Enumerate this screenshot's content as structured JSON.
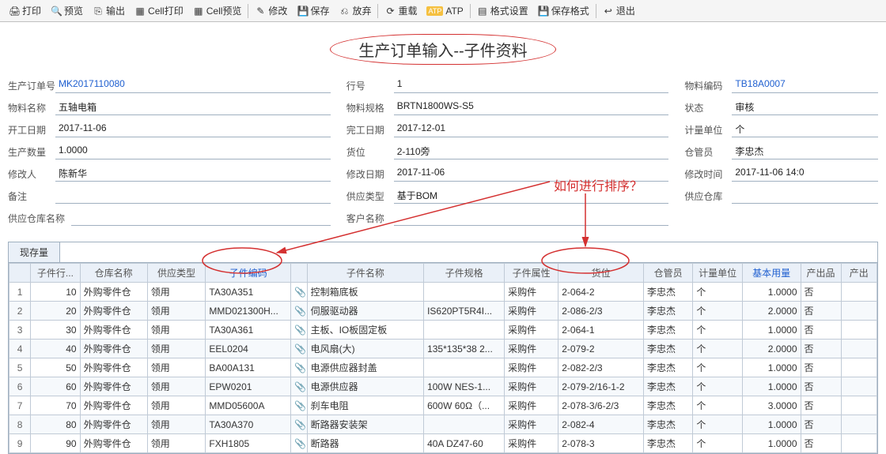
{
  "toolbar": {
    "print": "打印",
    "preview": "预览",
    "export": "输出",
    "cellprint": "Cell打印",
    "cellpreview": "Cell预览",
    "edit": "修改",
    "save": "保存",
    "discard": "放弃",
    "reload": "重载",
    "atp": "ATP",
    "format": "格式设置",
    "saveformat": "保存格式",
    "exit": "退出"
  },
  "title": "生产订单输入--子件资料",
  "annotation_text": "如何进行排序？",
  "form": {
    "left": {
      "order_no_label": "生产订单号",
      "order_no": "MK2017110080",
      "material_name_label": "物料名称",
      "material_name": "五轴电箱",
      "start_date_label": "开工日期",
      "start_date": "2017-11-06",
      "qty_label": "生产数量",
      "qty": "1.0000",
      "modifier_label": "修改人",
      "modifier": "陈新华",
      "remark_label": "备注",
      "remark": "",
      "supply_wh_name_label": "供应仓库名称",
      "supply_wh_name": ""
    },
    "mid": {
      "line_label": "行号",
      "line": "1",
      "spec_label": "物料规格",
      "spec": "BRTN1800WS-S5",
      "end_date_label": "完工日期",
      "end_date": "2017-12-01",
      "location_label": "货位",
      "location": "2-110旁",
      "mod_date_label": "修改日期",
      "mod_date": "2017-11-06",
      "supply_type_label": "供应类型",
      "supply_type": "基于BOM",
      "customer_label": "客户名称",
      "customer": ""
    },
    "right": {
      "material_code_label": "物料编码",
      "material_code": "TB18A0007",
      "status_label": "状态",
      "status": "审核",
      "uom_label": "计量单位",
      "uom": "个",
      "keeper_label": "仓管员",
      "keeper": "李忠杰",
      "mod_time_label": "修改时间",
      "mod_time": "2017-11-06 14:0",
      "supply_wh_label": "供应仓库",
      "supply_wh": ""
    }
  },
  "tab": "现存量",
  "columns": [
    "子件行...",
    "仓库名称",
    "供应类型",
    "子件编码",
    "",
    "子件名称",
    "子件规格",
    "子件属性",
    "货位",
    "仓管员",
    "计量单位",
    "基本用量",
    "产出品",
    "产出"
  ],
  "rows": [
    {
      "n": "1",
      "line": "10",
      "wh": "外购零件仓",
      "st": "领用",
      "code": "TA30A351",
      "name": "控制箱底板",
      "spec": "",
      "attr": "采购件",
      "loc": "2-064-2",
      "kp": "李忠杰",
      "uom": "个",
      "qty": "1.0000",
      "out": "否"
    },
    {
      "n": "2",
      "line": "20",
      "wh": "外购零件仓",
      "st": "领用",
      "code": "MMD021300H...",
      "name": "伺服驱动器",
      "spec": "IS620PT5R4I...",
      "attr": "采购件",
      "loc": "2-086-2/3",
      "kp": "李忠杰",
      "uom": "个",
      "qty": "2.0000",
      "out": "否"
    },
    {
      "n": "3",
      "line": "30",
      "wh": "外购零件仓",
      "st": "领用",
      "code": "TA30A361",
      "name": "主板、IO板固定板",
      "spec": "",
      "attr": "采购件",
      "loc": "2-064-1",
      "kp": "李忠杰",
      "uom": "个",
      "qty": "1.0000",
      "out": "否"
    },
    {
      "n": "4",
      "line": "40",
      "wh": "外购零件仓",
      "st": "领用",
      "code": "EEL0204",
      "name": "电风扇(大)",
      "spec": "135*135*38 2...",
      "attr": "采购件",
      "loc": "2-079-2",
      "kp": "李忠杰",
      "uom": "个",
      "qty": "2.0000",
      "out": "否"
    },
    {
      "n": "5",
      "line": "50",
      "wh": "外购零件仓",
      "st": "领用",
      "code": "BA00A131",
      "name": "电源供应器封盖",
      "spec": "",
      "attr": "采购件",
      "loc": "2-082-2/3",
      "kp": "李忠杰",
      "uom": "个",
      "qty": "1.0000",
      "out": "否"
    },
    {
      "n": "6",
      "line": "60",
      "wh": "外购零件仓",
      "st": "领用",
      "code": "EPW0201",
      "name": "电源供应器",
      "spec": "100W NES-1...",
      "attr": "采购件",
      "loc": "2-079-2/16-1-2",
      "kp": "李忠杰",
      "uom": "个",
      "qty": "1.0000",
      "out": "否"
    },
    {
      "n": "7",
      "line": "70",
      "wh": "外购零件仓",
      "st": "领用",
      "code": "MMD05600A",
      "name": "刹车电阻",
      "spec": "600W 60Ω（...",
      "attr": "采购件",
      "loc": "2-078-3/6-2/3",
      "kp": "李忠杰",
      "uom": "个",
      "qty": "3.0000",
      "out": "否"
    },
    {
      "n": "8",
      "line": "80",
      "wh": "外购零件仓",
      "st": "领用",
      "code": "TA30A370",
      "name": "断路器安装架",
      "spec": "",
      "attr": "采购件",
      "loc": "2-082-4",
      "kp": "李忠杰",
      "uom": "个",
      "qty": "1.0000",
      "out": "否"
    },
    {
      "n": "9",
      "line": "90",
      "wh": "外购零件仓",
      "st": "领用",
      "code": "FXH1805",
      "name": "断路器",
      "spec": "40A DZ47-60",
      "attr": "采购件",
      "loc": "2-078-3",
      "kp": "李忠杰",
      "uom": "个",
      "qty": "1.0000",
      "out": "否"
    }
  ]
}
